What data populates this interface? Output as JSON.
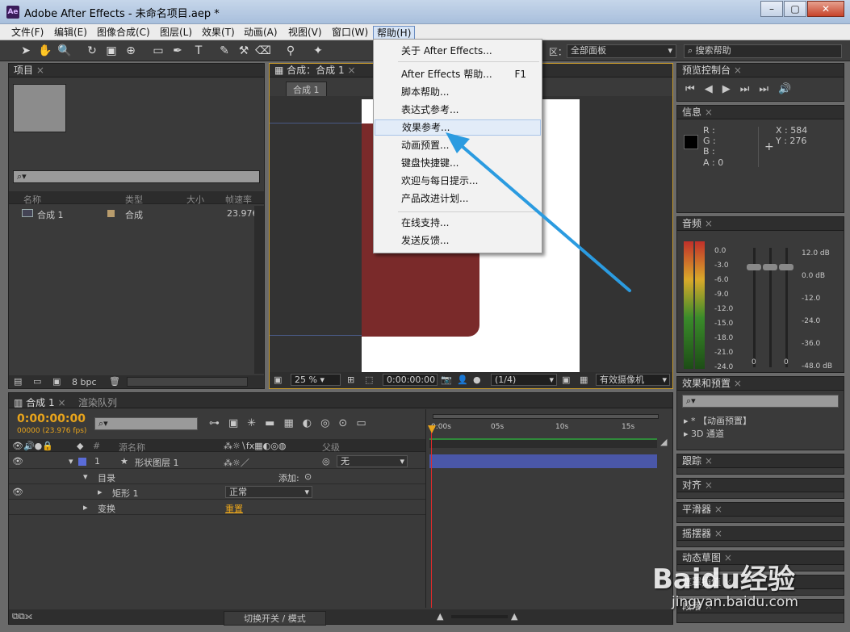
{
  "window": {
    "logo": "Ae",
    "title": "Adobe After Effects - 未命名项目.aep *",
    "controls": [
      "–",
      "▢",
      "✕"
    ]
  },
  "menu": [
    "文件(F)",
    "编辑(E)",
    "图像合成(C)",
    "图层(L)",
    "效果(T)",
    "动画(A)",
    "视图(V)",
    "窗口(W)",
    "帮助(H)"
  ],
  "toolbar": {
    "workspace_label": "区：",
    "workspace_value": "全部面板",
    "search_help": "搜索帮助"
  },
  "help_menu": {
    "items": [
      {
        "label": "关于 After Effects...",
        "shortcut": ""
      },
      {
        "label": "After Effects 帮助...",
        "shortcut": "F1"
      },
      {
        "label": "脚本帮助...",
        "shortcut": ""
      },
      {
        "label": "表达式参考...",
        "shortcut": ""
      },
      {
        "label": "效果参考...",
        "shortcut": ""
      },
      {
        "label": "动画预置...",
        "shortcut": ""
      },
      {
        "label": "键盘快捷键...",
        "shortcut": ""
      },
      {
        "label": "欢迎与每日提示...",
        "shortcut": ""
      },
      {
        "label": "产品改进计划...",
        "shortcut": ""
      },
      {
        "label": "在线支持...",
        "shortcut": ""
      },
      {
        "label": "发送反馈...",
        "shortcut": ""
      }
    ]
  },
  "project": {
    "tab": "项目",
    "columns": [
      "名称",
      "类型",
      "大小",
      "帧速率"
    ],
    "items": [
      {
        "name": "合成 1",
        "type": "合成",
        "fps": "23.976"
      }
    ],
    "bpc": "8 bpc"
  },
  "composition": {
    "tab": "合成：合成 1",
    "subtab": "合成 1",
    "zoom": "25 %",
    "time": "0:00:00:00",
    "resolution": "(1/4)",
    "camera": "有效摄像机"
  },
  "preview": {
    "tab": "预览控制台"
  },
  "info": {
    "tab": "信息",
    "r": "R :",
    "g": "G :",
    "b": "B :",
    "a": "A : 0",
    "x": "X : 584",
    "y": "Y : 276"
  },
  "audio": {
    "tab": "音频",
    "left_scale": [
      "0.0",
      "-3.0",
      "-6.0",
      "-9.0",
      "-12.0",
      "-15.0",
      "-18.0",
      "-21.0",
      "-24.0"
    ],
    "right_scale": [
      "12.0 dB",
      "0.0 dB",
      "-12.0",
      "-24.0",
      "-36.0",
      "-48.0 dB"
    ],
    "zero_a": "0",
    "zero_b": "0"
  },
  "effects": {
    "tab": "效果和预置",
    "items": [
      "* 【动画预置】",
      "3D 通道"
    ]
  },
  "side_panels": [
    "跟踪",
    "对齐",
    "平滑器",
    "摇摆器",
    "动态草图",
    "遮罩插值",
    "段落"
  ],
  "timeline": {
    "tabs": [
      "合成 1",
      "渲染队列"
    ],
    "timecode": "0:00:00:00",
    "fps": "00000 (23.976 fps)",
    "ruler": [
      "0:00s",
      "05s",
      "10s",
      "15s"
    ],
    "col_headers": {
      "num": "#",
      "source": "源名称",
      "parent": "父级"
    },
    "layers": [
      {
        "num": "1",
        "name": "形状图层 1",
        "parent": "无"
      }
    ],
    "contents_label": "目录",
    "add_label": "添加:",
    "rect_label": "矩形 1",
    "blend_mode": "正常",
    "transform_label": "变换",
    "reset_label": "重置",
    "footer_toggle": "切换开关 / 模式"
  },
  "watermark": {
    "brand": "Baidu经验",
    "url": "jingyan.baidu.com"
  },
  "colors": {
    "accent_orange": "#e8a41c",
    "shape_color": "#7a2a2a",
    "menu_highlight": "#e2ecf8",
    "arrow": "#2b9be0"
  }
}
